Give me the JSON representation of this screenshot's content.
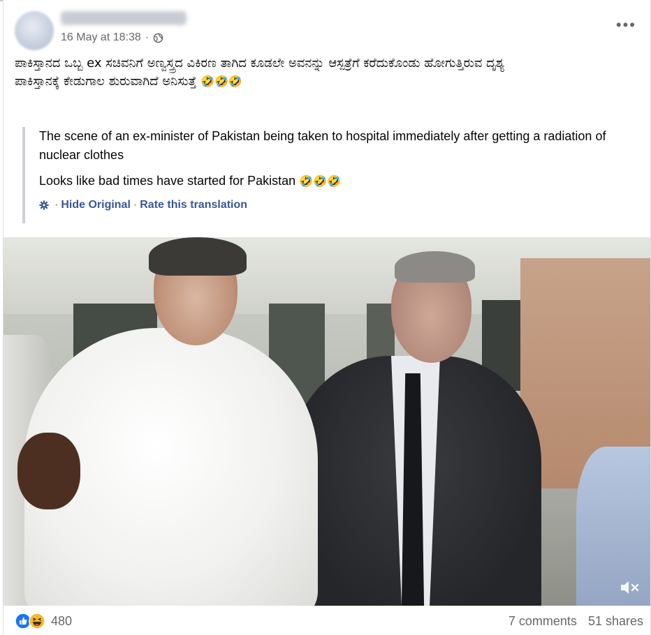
{
  "post": {
    "timestamp": "16 May at 18:38",
    "separator": "·",
    "more_label": "•••",
    "text_line1": "ಪಾಕಿಸ್ತಾನದ ಒಬ್ಬ ex ಸಚಿವನಿಗೆ ಅಣ್ವಸ್ತ್ರದ ವಿಕಿರಣ ತಾಗಿದ ಕೂಡಲೇ  ಅವನನ್ನು ಆಸ್ಪತ್ರೆಗೆ ಕರೆದುಕೊಂಡು ಹೋಗುತ್ತಿರುವ ದೃಶ್ಯ",
    "text_line2": "ಪಾಕಿಸ್ತಾನಕ್ಕೆ ಕೇಡುಗಾಲ ಶುರುವಾಗಿದೆ ಅನಿಸುತ್ತೆ",
    "emojis": "🤣🤣🤣"
  },
  "translation": {
    "line1": "The scene of an ex-minister of Pakistan being taken to hospital immediately after getting a radiation of nuclear clothes",
    "line2": "Looks like bad times have started for Pakistan",
    "emojis": "🤣🤣🤣",
    "hide_original": "Hide Original",
    "link_separator": "·",
    "rate": "Rate this translation"
  },
  "footer": {
    "reaction_count": "480",
    "comments": "7 comments",
    "shares": "51 shares"
  },
  "icons": {
    "privacy": "globe-icon",
    "settings": "gear-icon",
    "mute": "muted-speaker-icon",
    "reactions": [
      "like-icon",
      "haha-icon"
    ]
  },
  "colors": {
    "link": "#385898",
    "secondary_text": "#65676b",
    "like_blue": "#1877f2",
    "haha_yellow": "#f7b928"
  }
}
